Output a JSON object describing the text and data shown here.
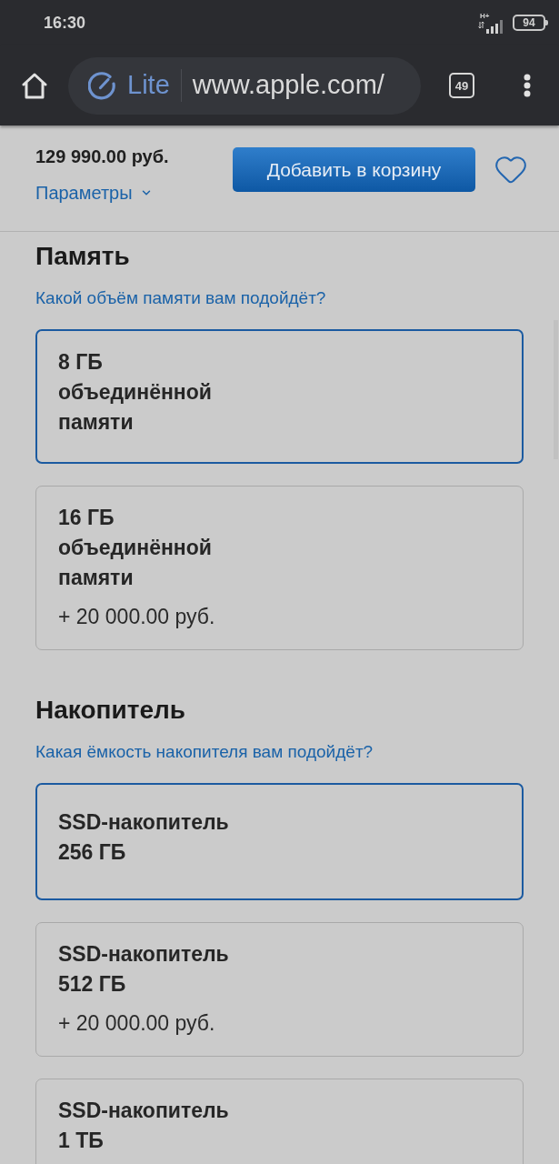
{
  "status_bar": {
    "time": "16:30",
    "network": "H+",
    "battery": "94"
  },
  "browser": {
    "mode": "Lite",
    "url": "www.apple.com/",
    "tab_count": "49"
  },
  "purchase_bar": {
    "price": "129 990.00 руб.",
    "parameters_link": "Параметры",
    "add_button": "Добавить в корзину"
  },
  "sections": [
    {
      "title": "Память",
      "help_link": "Какой объём памяти вам подойдёт?",
      "options": [
        {
          "title_lines": [
            "8 ГБ",
            "объединённой",
            "памяти"
          ],
          "selected": true
        },
        {
          "title_lines": [
            "16 ГБ",
            "объединённой",
            "памяти"
          ],
          "price": "+ 20 000.00 руб.",
          "selected": false
        }
      ]
    },
    {
      "title": "Накопитель",
      "help_link": "Какая ёмкость накопителя вам подойдёт?",
      "options": [
        {
          "title_lines": [
            "SSD-накопитель",
            "256 ГБ"
          ],
          "selected": true
        },
        {
          "title_lines": [
            "SSD-накопитель",
            "512 ГБ"
          ],
          "price": "+ 20 000.00 руб.",
          "selected": false
        },
        {
          "title_lines": [
            "SSD-накопитель",
            "1 ТБ"
          ],
          "selected": false
        }
      ]
    }
  ]
}
